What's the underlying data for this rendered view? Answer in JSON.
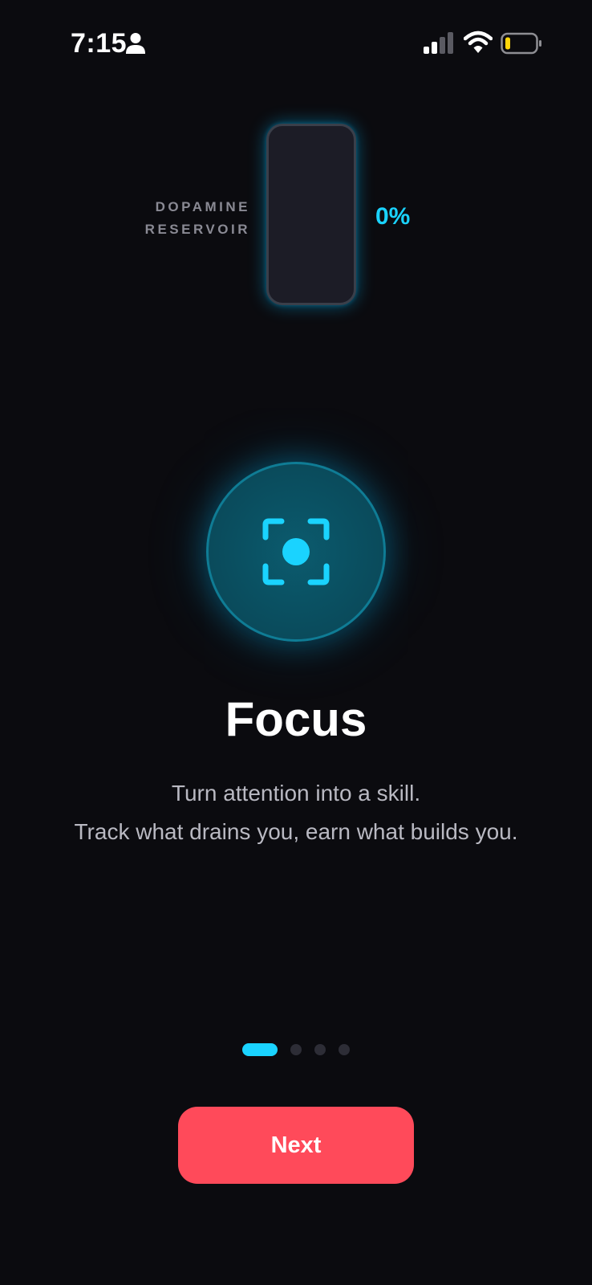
{
  "status_bar": {
    "time": "7:15",
    "icons": [
      "person-icon",
      "cellular-signal-icon",
      "wifi-icon",
      "battery-icon"
    ],
    "battery_level": "low",
    "battery_color": "#ffd60a"
  },
  "reservoir": {
    "label_line1": "DOPAMINE",
    "label_line2": "RESERVOIR",
    "percent_text": "0%",
    "fill_fraction": 0
  },
  "feature": {
    "icon": "focus-viewfinder-icon",
    "title": "Focus",
    "subtitle_line1": "Turn attention into a skill.",
    "subtitle_line2": "Track what drains you, earn what builds you."
  },
  "pagination": {
    "total": 4,
    "active_index": 0
  },
  "actions": {
    "next_label": "Next"
  },
  "colors": {
    "background": "#0b0b0f",
    "accent": "#1ad3ff",
    "button": "#ff4a5a"
  }
}
